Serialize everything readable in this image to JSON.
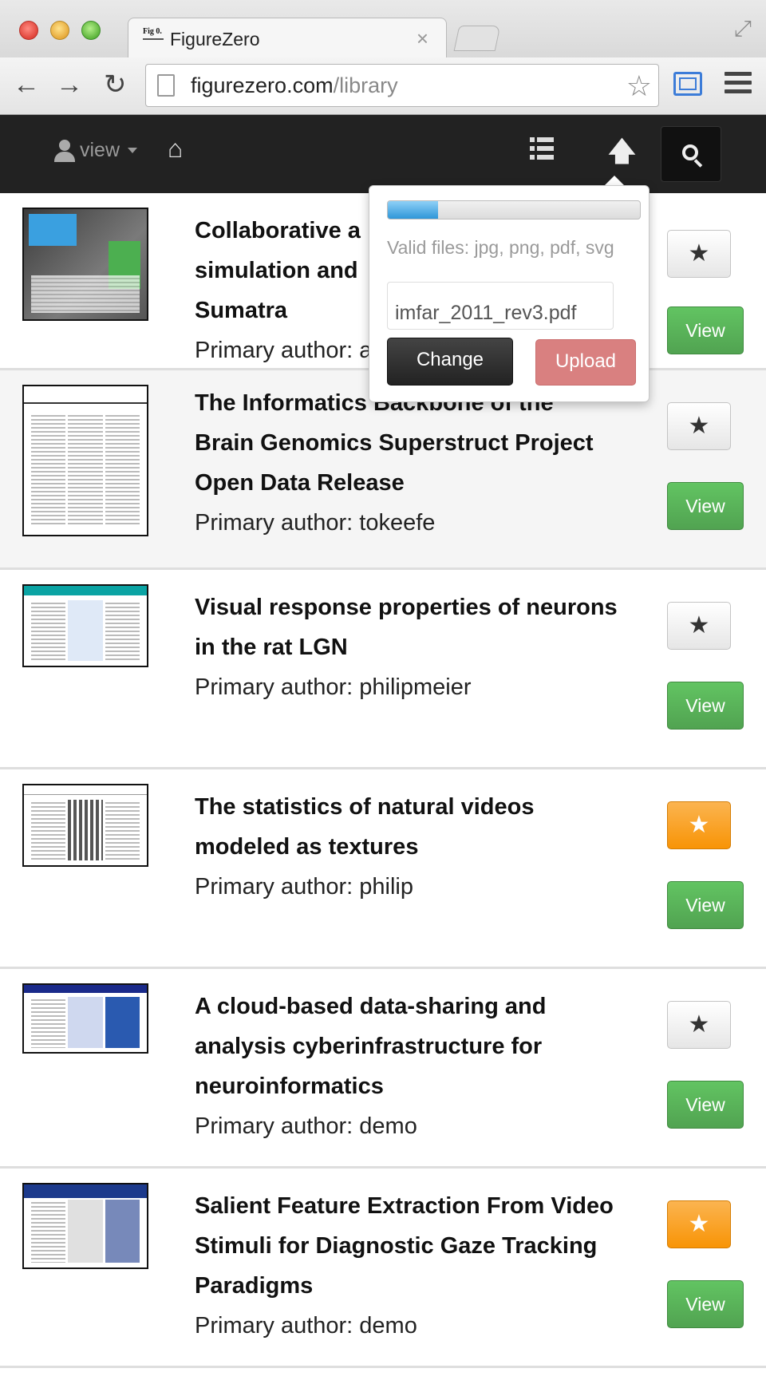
{
  "browser": {
    "tab_title": "FigureZero",
    "tab_favicon_text": "Fig 0.",
    "url_host": "figurezero.com",
    "url_path": "/library"
  },
  "navbar": {
    "user_label": "view"
  },
  "upload_popover": {
    "progress_percent": 20,
    "valid_files": "Valid files: jpg, png, pdf, svg",
    "file_name": "imfar_2011_rev3.pdf",
    "change_label": "Change",
    "upload_label": "Upload",
    "upload_color": "#d98080"
  },
  "colors": {
    "navbar_bg": "#222222",
    "view_button": "#51a351",
    "starred": "#f89406"
  },
  "posters": [
    {
      "title": "Collaborative a simulation and Sumatra",
      "title_lines": [
        "Collaborative a",
        "simulation and",
        "Sumatra"
      ],
      "author": "Primary author: a",
      "starred": false,
      "view_label": "View",
      "star_glyph": "★"
    },
    {
      "title_lines": [
        "The Informatics Backbone of the",
        "Brain Genomics Superstruct Project",
        "Open Data Release"
      ],
      "author": "Primary author: tokeefe",
      "starred": false,
      "view_label": "View",
      "star_glyph": "★"
    },
    {
      "title_lines": [
        "Visual response properties of neurons",
        "in the rat LGN"
      ],
      "author": "Primary author: philipmeier",
      "starred": false,
      "view_label": "View",
      "star_glyph": "★"
    },
    {
      "title_lines": [
        "The statistics of natural videos",
        "modeled as textures"
      ],
      "author": "Primary author: philip",
      "starred": true,
      "view_label": "View",
      "star_glyph": "★"
    },
    {
      "title_lines": [
        "A cloud-based data-sharing and",
        "analysis cyberinfrastructure for",
        "neuroinformatics"
      ],
      "author": "Primary author: demo",
      "starred": false,
      "view_label": "View",
      "star_glyph": "★"
    },
    {
      "title_lines": [
        "Salient Feature Extraction From Video",
        "Stimuli for Diagnostic Gaze Tracking",
        "Paradigms"
      ],
      "author": "Primary author: demo",
      "starred": true,
      "view_label": "View",
      "star_glyph": "★"
    }
  ]
}
